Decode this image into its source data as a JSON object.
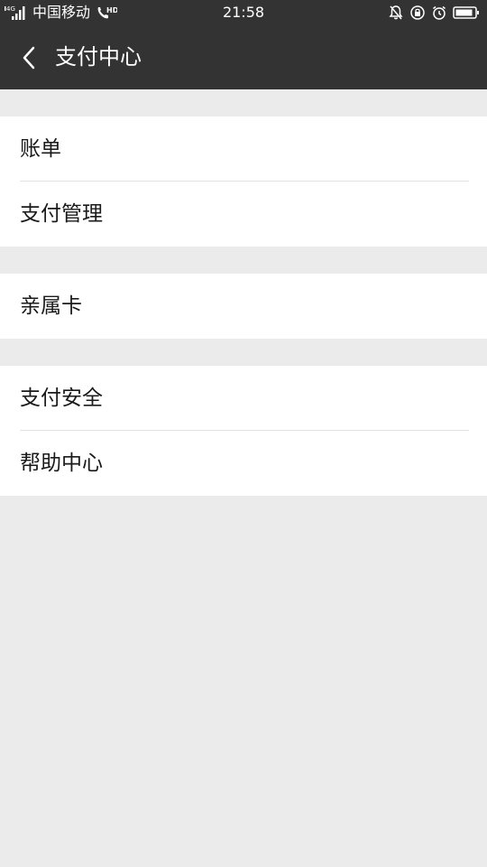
{
  "status_bar": {
    "network": "4G",
    "carrier": "中国移动",
    "hd_label": "HD",
    "time": "21:58"
  },
  "header": {
    "title": "支付中心"
  },
  "groups": [
    {
      "items": [
        {
          "label": "账单"
        },
        {
          "label": "支付管理"
        }
      ]
    },
    {
      "items": [
        {
          "label": "亲属卡"
        }
      ]
    },
    {
      "items": [
        {
          "label": "支付安全"
        },
        {
          "label": "帮助中心"
        }
      ]
    }
  ],
  "colors": {
    "header_bg": "#333333",
    "page_bg": "#ebebeb",
    "item_bg": "#ffffff",
    "divider": "#e2e2e2"
  }
}
